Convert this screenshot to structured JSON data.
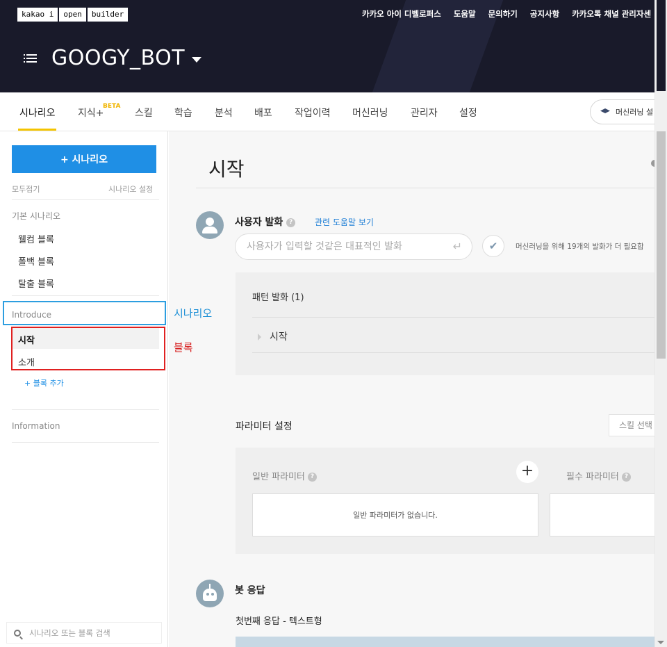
{
  "logo": [
    "kakao i",
    "open",
    "builder"
  ],
  "top_nav": [
    "카카오 아이 디벨로퍼스",
    "도움말",
    "문의하기",
    "공지사항",
    "카카오톡 채널 관리자센"
  ],
  "bot": {
    "name": "GOOGY_BOT"
  },
  "tabs": [
    {
      "label": "시나리오",
      "active": true
    },
    {
      "label": "지식+"
    },
    {
      "label": "스킬"
    },
    {
      "label": "학습"
    },
    {
      "label": "분석"
    },
    {
      "label": "배포"
    },
    {
      "label": "작업이력"
    },
    {
      "label": "머신러닝"
    },
    {
      "label": "관리자"
    },
    {
      "label": "설정"
    }
  ],
  "beta_badge": "BETA",
  "ml_button": "머신러닝 설",
  "sidebar": {
    "add_scenario": "+ 시나리오",
    "collapse_all": "모두접기",
    "scenario_settings": "시나리오 설정",
    "basic_group": "기본 시나리오",
    "basic_items": [
      "웰컴 블록",
      "폴백 블록",
      "탈출 블록"
    ],
    "introduce_group": "Introduce",
    "introduce_items": [
      "시작",
      "소개"
    ],
    "add_block": "+ 블록 추가",
    "information_group": "Information",
    "search_placeholder": "시나리오 또는 블록 검색"
  },
  "annotations": {
    "scenario": "시나리오",
    "block": "블록"
  },
  "main": {
    "title": "시작",
    "user_utterance": {
      "title": "사용자 발화",
      "help_link": "관련 도움말 보기",
      "placeholder": "사용자가 입력할 것같은 대표적인 발화",
      "ml_note": "머신러닝을 위해 19개의 발화가 더 필요합"
    },
    "pattern": {
      "title": "패턴 발화 (1)",
      "items": [
        "시작"
      ]
    },
    "params": {
      "title": "파라미터 설정",
      "skill_select": "스킬 선택",
      "general_label": "일반 파라미터",
      "required_label": "필수 파라미터",
      "general_empty": "일반 파라미터가 없습니다."
    },
    "bot_response": {
      "title": "봇 응답",
      "subtitle": "첫번째 응답 - 텍스트형"
    }
  }
}
